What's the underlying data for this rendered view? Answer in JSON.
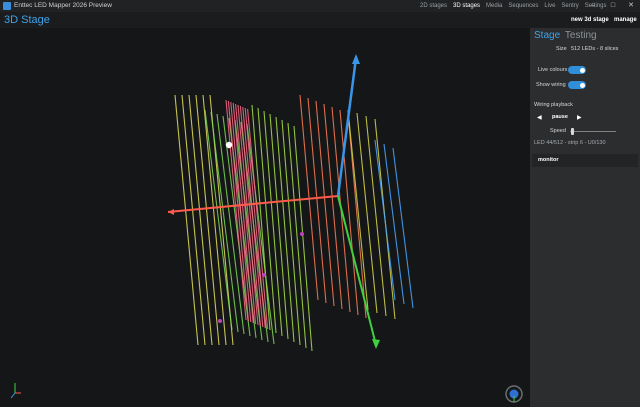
{
  "window": {
    "title": "Enttec LED Mapper 2026 Preview",
    "nav": [
      "2D stages",
      "3D stages",
      "Media",
      "Sequences",
      "Live",
      "Sentry",
      "Settings"
    ],
    "active_nav": "3D stages",
    "controls": [
      "–",
      "□",
      "✕"
    ]
  },
  "header": {
    "title": "3D Stage",
    "new_button": "new 3d stage",
    "manage_button": "manage"
  },
  "panel": {
    "tabs": [
      "Stage",
      "Testing"
    ],
    "size_label": "Size",
    "size_value": "512 LEDs - 8 slices",
    "live_colours_label": "Live colours",
    "live_colours_on": true,
    "show_wiring_label": "Show wiring",
    "show_wiring_on": true,
    "wiring_playback_label": "Wiring playback",
    "prev_symbol": "◀",
    "pause_label": "pause",
    "next_symbol": "▶",
    "speed_label": "Speed",
    "speed_fraction": 0.05,
    "status": "LED 44/512 - strip 6 - U0/130",
    "monitor_label": "monitor"
  },
  "colors": {
    "accent": "#3fa2e6",
    "axis_x": "#ff5a4a",
    "axis_y": "#3a95e8",
    "axis_z": "#3fd13f"
  },
  "icons": {
    "axis_gizmo": "axis-gizmo-icon",
    "orbit": "orbit-icon"
  }
}
